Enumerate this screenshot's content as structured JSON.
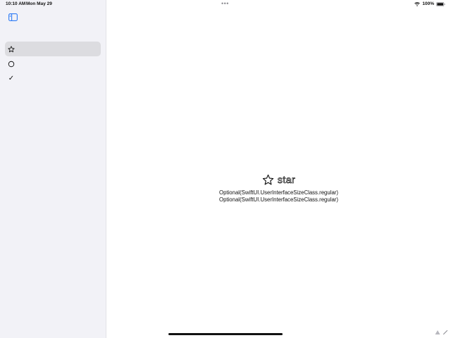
{
  "status_bar": {
    "time": "10:10 AM",
    "date": "Mon May 29",
    "multitask_dots": "•••",
    "battery_percent": "100%",
    "icons": [
      "wifi-icon",
      "battery-icon"
    ]
  },
  "sidebar": {
    "toggle_icon": "sidebar-toggle-icon",
    "items": [
      {
        "icon": "star-icon",
        "selected": true
      },
      {
        "icon": "circle-icon",
        "selected": false
      },
      {
        "icon": "checkmark-icon",
        "glyph": "✓",
        "selected": false
      }
    ]
  },
  "detail": {
    "title": "star",
    "title_icon": "star-icon",
    "size_class_lines": [
      "Optional(SwiftUI.UserInterfaceSizeClass.regular)",
      "Optional(SwiftUI.UserInterfaceSizeClass.regular)"
    ]
  },
  "corner_tools": [
    "triangle-icon",
    "pencil-icon"
  ],
  "colors": {
    "sidebar_background": "#f2f2f7",
    "selected_row": "#dcdce0",
    "accent": "#2f7cf6",
    "text": "#111111"
  }
}
